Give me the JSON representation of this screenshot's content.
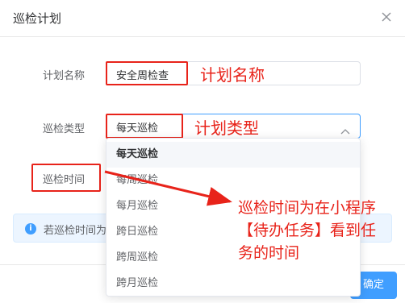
{
  "dialog": {
    "title": "巡检计划",
    "close_icon": "close-icon"
  },
  "form": {
    "plan_name": {
      "label": "计划名称",
      "value": "安全周检查"
    },
    "plan_type": {
      "label": "巡检类型",
      "value": "每天巡检",
      "chevron_icon": "chevron-up-icon"
    },
    "inspect_time": {
      "label": "巡检时间"
    }
  },
  "dropdown": {
    "options": [
      "每天巡检",
      "每周巡检",
      "每月巡检",
      "跨日巡检",
      "跨周巡检",
      "跨月巡检"
    ],
    "selected": "每天巡检"
  },
  "info_bar": {
    "icon": "info-icon",
    "text": "若巡检时间为"
  },
  "footer": {
    "confirm_label": "确定"
  },
  "annotations": {
    "plan_name_note": "计划名称",
    "plan_type_note": "计划类型",
    "time_note_line1": "巡检时间为在小程序",
    "time_note_line2": "【待办任务】看到任",
    "time_note_line3": "务的时间",
    "color": "#e8231a"
  },
  "colors": {
    "primary": "#409eff",
    "info_bg": "#ecf5ff",
    "annotation_red": "#e8231a"
  }
}
